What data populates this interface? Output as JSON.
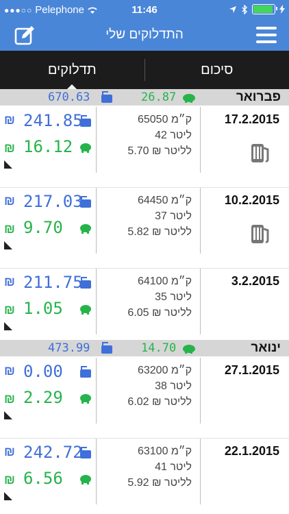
{
  "status_bar": {
    "carrier": "Pelephone",
    "time": "11:46"
  },
  "nav": {
    "title": "התדלוקים שלי"
  },
  "tabs": [
    {
      "label": "תדלוקים"
    },
    {
      "label": "סיכום"
    }
  ],
  "months": [
    {
      "name": "פברואר",
      "total": "670.63",
      "savings": "26.87",
      "entries": [
        {
          "date": "17.2.2015",
          "km": "65050 ק״מ",
          "liters": "42 ליטר",
          "price": "5.70 ₪ לליטר",
          "cost": "241.85",
          "savings": "16.12"
        },
        {
          "date": "10.2.2015",
          "km": "64450 ק״מ",
          "liters": "37 ליטר",
          "price": "5.82 ₪ לליטר",
          "cost": "217.03",
          "savings": "9.70"
        },
        {
          "date": "3.2.2015",
          "km": "64100 ק״מ",
          "liters": "35 ליטר",
          "price": "6.05 ₪ לליטר",
          "cost": "211.75",
          "savings": "1.05"
        }
      ]
    },
    {
      "name": "ינואר",
      "total": "473.99",
      "savings": "14.70",
      "entries": [
        {
          "date": "27.1.2015",
          "km": "63200 ק״מ",
          "liters": "38 ליטר",
          "price": "6.02 ₪ לליטר",
          "cost": "0.00",
          "savings": "2.29"
        },
        {
          "date": "22.1.2015",
          "km": "63100 ק״מ",
          "liters": "41 ליטר",
          "price": "5.92 ₪ לליטר",
          "cost": "242.72",
          "savings": "6.56"
        }
      ]
    }
  ],
  "currency_symbol": "₪",
  "icons": {
    "edit": "edit-icon",
    "menu": "menu-icon",
    "pump": "fuel-pump-icon",
    "can": "fuel-can-icon",
    "piggy": "piggy-bank-icon"
  },
  "colors": {
    "header_blue": "#4a86d8",
    "cost_blue": "#3f6fd8",
    "savings_green": "#27b34b",
    "tab_bar": "#1c1c1c"
  }
}
